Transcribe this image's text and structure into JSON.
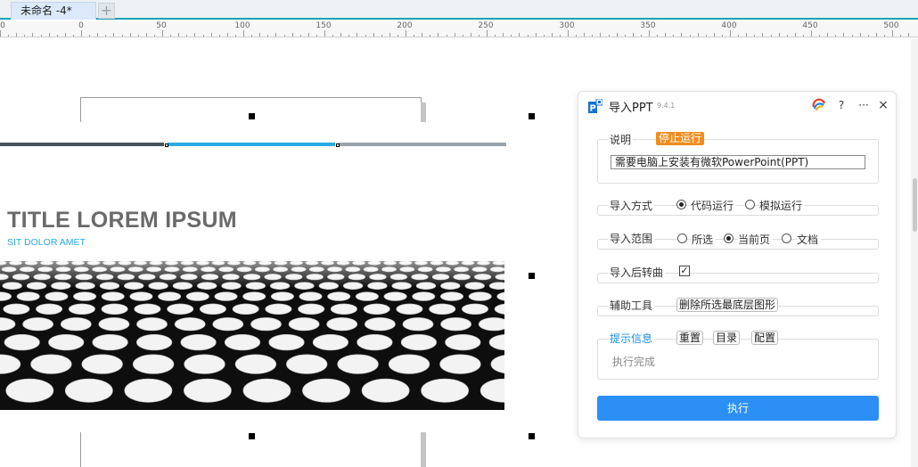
{
  "tabs": {
    "active_label": "未命名 -4*",
    "add_label": "+"
  },
  "ruler": {
    "marks": [
      "0",
      "0",
      "50",
      "100",
      "150",
      "200",
      "250",
      "300",
      "350",
      "400",
      "450",
      "500"
    ]
  },
  "slide": {
    "title": "TITLE LOREM IPSUM",
    "subtitle": "SIT DOLOR AMET"
  },
  "panel": {
    "title": "导入PPT",
    "version": "9.4.1",
    "help_label": "?",
    "more_label": "···",
    "close_label": "×",
    "note": {
      "label": "说明",
      "badge": "停止运行",
      "text": "需要电脑上安装有微软PowerPoint(PPT)"
    },
    "mode": {
      "label": "导入方式",
      "options": [
        "代码运行",
        "模拟运行"
      ],
      "selected": "代码运行"
    },
    "scope": {
      "label": "导入范围",
      "options": [
        "所选",
        "当前页",
        "文档"
      ],
      "selected": "当前页"
    },
    "convert": {
      "label": "导入后转曲",
      "checked": true,
      "check_mark": "✓"
    },
    "tools": {
      "label": "辅助工具",
      "delete_bottom_label": "删除所选最底层图形"
    },
    "hint": {
      "label": "提示信息",
      "reset_label": "重置",
      "catalog_label": "目录",
      "config_label": "配置",
      "log": "执行完成"
    },
    "run_label": "执行"
  },
  "colors": {
    "accent": "#2b8ff5",
    "badge": "#f08d1e",
    "hint": "#1a8fe3",
    "subtitle": "#2aaae1",
    "tab_underline": "#1aa3b8"
  }
}
